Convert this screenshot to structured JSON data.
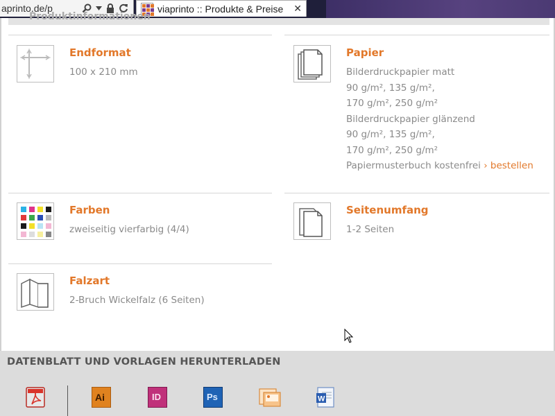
{
  "browser": {
    "address_text": "aprinto.de/p",
    "tab_title": "viaprinto :: Produkte & Preise",
    "tab_close": "✕"
  },
  "section_header": "Produktinformationen",
  "items": [
    {
      "label": "Endformat",
      "desc": [
        "100 x 210 mm"
      ],
      "icon": "format-dimensions-icon"
    },
    {
      "label": "Papier",
      "desc": [
        "Bilderdruckpapier matt",
        "90 g/m², 135 g/m²,",
        "170 g/m², 250 g/m²",
        "Bilderdruckpapier glänzend",
        "90 g/m², 135 g/m²,",
        "170 g/m², 250 g/m²"
      ],
      "swatch_book_text": "Papiermusterbuch kostenfrei",
      "order_link": "› bestellen",
      "icon": "paper-stack-icon"
    },
    {
      "label": "Farben",
      "desc": [
        "zweiseitig vierfarbig (4/4)"
      ],
      "icon": "color-grid-icon"
    },
    {
      "label": "Seitenumfang",
      "desc": [
        "1-2 Seiten"
      ],
      "icon": "pages-icon"
    },
    {
      "label": "Falzart",
      "desc": [
        "2-Bruch Wickelfalz (6 Seiten)"
      ],
      "icon": "fold-icon"
    }
  ],
  "download": {
    "title": "DATENBLATT UND VORLAGEN HERUNTERLADEN",
    "files": [
      {
        "name": "pdf",
        "glyph": "",
        "color": "#d9342b"
      },
      {
        "name": "illustrator",
        "glyph": "Ai",
        "color": "#e0821f"
      },
      {
        "name": "indesign",
        "glyph": "ID",
        "color": "#c0317a"
      },
      {
        "name": "photoshop",
        "glyph": "Ps",
        "color": "#1f63b5"
      },
      {
        "name": "image",
        "glyph": "",
        "color": "#f0a24c"
      },
      {
        "name": "word",
        "glyph": "W",
        "color": "#2a5db0"
      }
    ]
  },
  "colors": {
    "accent": "#e2782a",
    "text": "#8a8a8a"
  }
}
